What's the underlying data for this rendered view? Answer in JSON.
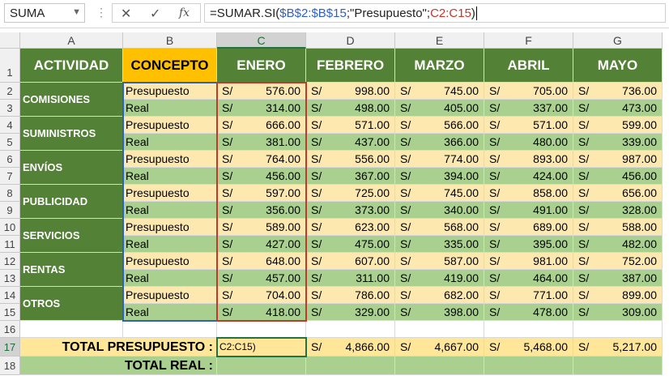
{
  "formula_bar": {
    "name_box": "SUMA",
    "formula_prefix": "=SUMAR.SI(",
    "formula_range1": "$B$2:$B$15",
    "formula_mid": ";\"Presupuesto\";",
    "formula_range2": "C2:C15",
    "formula_suffix": ")",
    "cancel_icon": "✕",
    "enter_icon": "✓",
    "fx_icon": "fx"
  },
  "columns": [
    "A",
    "B",
    "C",
    "D",
    "E",
    "F",
    "G"
  ],
  "rows": [
    "1",
    "2",
    "3",
    "4",
    "5",
    "6",
    "7",
    "8",
    "9",
    "10",
    "11",
    "12",
    "13",
    "14",
    "15",
    "16",
    "17",
    "18"
  ],
  "headers": {
    "actividad": "ACTIVIDAD",
    "concepto": "CONCEPTO",
    "months": [
      "ENERO",
      "FEBRERO",
      "MARZO",
      "ABRIL",
      "MAYO"
    ]
  },
  "currency": "S/",
  "groups": [
    {
      "actividad": "COMISIONES",
      "presupuesto": [
        "576.00",
        "998.00",
        "745.00",
        "705.00",
        "736.00"
      ],
      "real": [
        "314.00",
        "498.00",
        "405.00",
        "337.00",
        "473.00"
      ]
    },
    {
      "actividad": "SUMINISTROS",
      "presupuesto": [
        "666.00",
        "571.00",
        "566.00",
        "571.00",
        "599.00"
      ],
      "real": [
        "381.00",
        "437.00",
        "366.00",
        "480.00",
        "339.00"
      ]
    },
    {
      "actividad": "ENVÍOS",
      "presupuesto": [
        "764.00",
        "556.00",
        "774.00",
        "893.00",
        "987.00"
      ],
      "real": [
        "456.00",
        "367.00",
        "394.00",
        "424.00",
        "456.00"
      ]
    },
    {
      "actividad": "PUBLICIDAD",
      "presupuesto": [
        "597.00",
        "725.00",
        "745.00",
        "858.00",
        "656.00"
      ],
      "real": [
        "356.00",
        "373.00",
        "340.00",
        "491.00",
        "328.00"
      ]
    },
    {
      "actividad": "SERVICIOS",
      "presupuesto": [
        "589.00",
        "623.00",
        "568.00",
        "689.00",
        "588.00"
      ],
      "real": [
        "427.00",
        "475.00",
        "335.00",
        "395.00",
        "482.00"
      ]
    },
    {
      "actividad": "RENTAS",
      "presupuesto": [
        "648.00",
        "607.00",
        "587.00",
        "981.00",
        "752.00"
      ],
      "real": [
        "457.00",
        "311.00",
        "419.00",
        "464.00",
        "387.00"
      ]
    },
    {
      "actividad": "OTROS",
      "presupuesto": [
        "704.00",
        "786.00",
        "682.00",
        "771.00",
        "899.00"
      ],
      "real": [
        "418.00",
        "329.00",
        "398.00",
        "478.00",
        "309.00"
      ]
    }
  ],
  "labels": {
    "presupuesto": "Presupuesto",
    "real": "Real"
  },
  "totals": {
    "presupuesto_label": "TOTAL PRESUPUESTO :",
    "real_label": "TOTAL REAL :",
    "editing_text": "C2:C15)",
    "presupuesto_values": [
      "4,866.00",
      "4,667.00",
      "5,468.00",
      "5,217.00"
    ]
  },
  "colors": {
    "green": "#538135",
    "yellow": "#ffc000",
    "light_green": "#a9d08e",
    "light_yellow": "#fde9b0",
    "ref_blue": "#2f5fc4",
    "ref_red": "#c0392b"
  }
}
